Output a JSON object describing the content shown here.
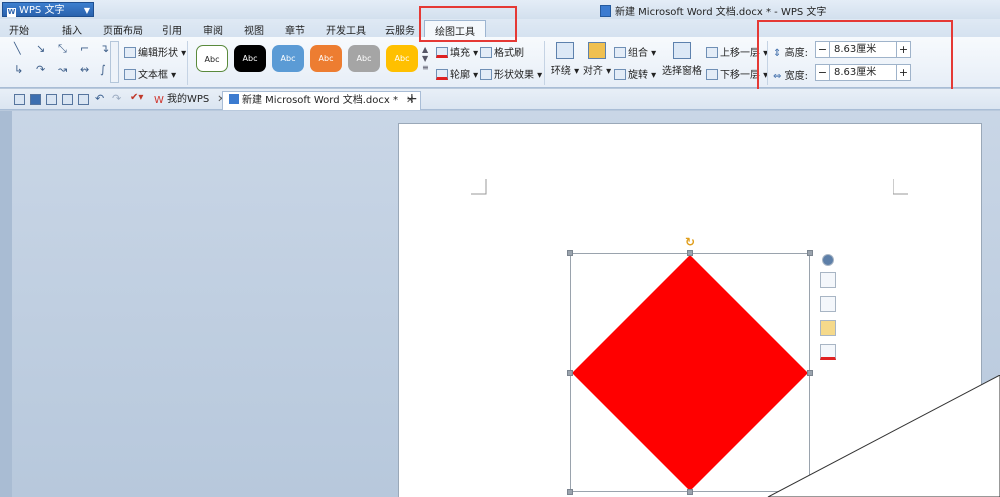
{
  "titlebar": {
    "app_name": "WPS 文字",
    "document_title": "新建 Microsoft Word 文档.docx * - WPS 文字"
  },
  "menu_tabs": [
    "开始",
    "插入",
    "页面布局",
    "引用",
    "审阅",
    "视图",
    "章节",
    "开发工具",
    "云服务",
    "绘图工具"
  ],
  "active_tab": "绘图工具",
  "ribbon": {
    "edit_shape": "编辑形状",
    "text_box": "文本框",
    "style_label": "Abc",
    "fill": "填充",
    "format_brush": "格式刷",
    "outline": "轮廓",
    "shape_effects": "形状效果",
    "wrap": "环绕",
    "align": "对齐",
    "group": "组合",
    "rotate": "旋转",
    "select_pane": "选择窗格",
    "bring_forward": "上移一层",
    "send_backward": "下移一层",
    "height_label": "高度:",
    "height_value": "8.63厘米",
    "width_label": "宽度:",
    "width_value": "8.63厘米"
  },
  "doc_tabs": {
    "my_wps": "我的WPS",
    "current_doc": "新建 Microsoft Word 文档.docx *"
  },
  "colors": {
    "diamond_fill": "#ff0000",
    "highlight": "#e53935",
    "style_fills": [
      "#ffffff",
      "#000000",
      "#5b9bd5",
      "#ed7d31",
      "#a5a5a5",
      "#ffc000"
    ]
  }
}
